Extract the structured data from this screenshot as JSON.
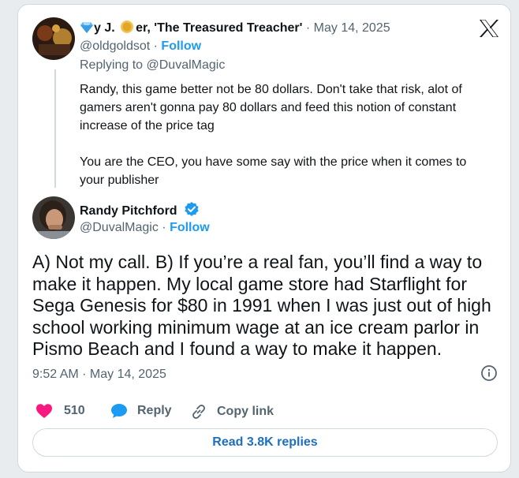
{
  "reply_tweet": {
    "name_part1": "y J.",
    "name_part2": "er, 'The Treasured Treacher'",
    "date": "May 14, 2025",
    "handle": "@oldgoldsot",
    "follow": "Follow",
    "replying_to_prefix": "Replying to",
    "replying_to_handle": "@DuvalMagic",
    "paragraph1": "Randy, this game better not be 80 dollars. Don't take that risk, alot of gamers aren't gonna pay 80 dollars and feed this notion of constant increase of the price tag",
    "paragraph2": "You are the CEO, you have some say with the price when it comes to your publisher"
  },
  "main_tweet": {
    "name": "Randy Pitchford",
    "handle": "@DuvalMagic",
    "follow": "Follow",
    "text": "A) Not my call. B) If you’re a real fan, you’ll find a way to make it happen. My local game store had Starflight for Sega Genesis for $80 in 1991 when I was just out of high school working minimum wage at an ice cream parlor in Pismo Beach and I found a way to make it happen.",
    "timestamp": "9:52 AM · May 14, 2025"
  },
  "actions": {
    "likes": "510",
    "reply": "Reply",
    "copy_link": "Copy link"
  },
  "read_replies": "Read 3.8K replies",
  "separator": "·",
  "colors": {
    "link_blue": "#1d9bf0",
    "heart_pink": "#f91880",
    "muted": "#536471",
    "verified": "#1d9bf0"
  },
  "icons": {
    "diamond": "gem-emoji",
    "coin": "coin-emoji",
    "platform_logo": "x-logo",
    "heart": "heart-icon",
    "reply": "speech-bubble-icon",
    "link": "link-icon",
    "info": "info-icon",
    "verified": "verified-badge-icon"
  }
}
